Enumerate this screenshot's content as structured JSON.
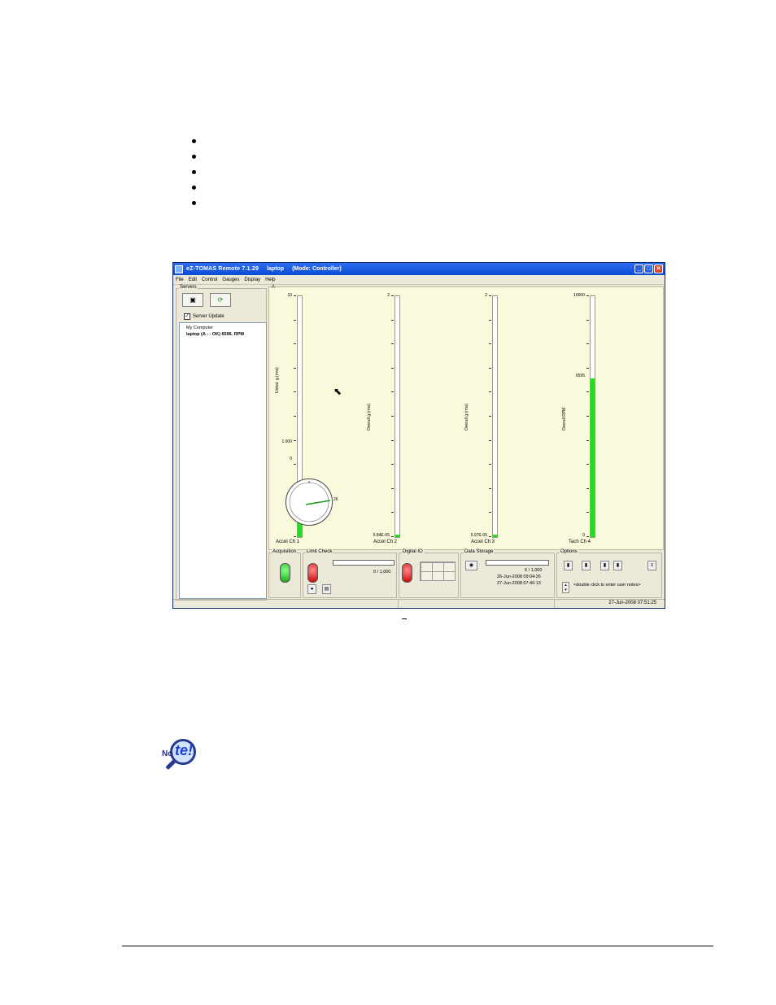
{
  "window": {
    "title": "eZ-TOMAS Remote 7.1.29",
    "server": "laptop",
    "mode": "(Mode:  Controller)",
    "min": "_",
    "max": "□",
    "close": "✕"
  },
  "menu": [
    "File",
    "Edit",
    "Control",
    "Gauges",
    "Display",
    "Help"
  ],
  "servers": {
    "label": "Servers",
    "server_update": "Server Update",
    "tree_root": "My Computer",
    "tree_item": "laptop   (A - -   OK)   6596. RPM"
  },
  "panel_label": "A",
  "gauges": [
    {
      "name": "Accel Ch 1",
      "axis": "Unbal. g (rms)",
      "top": "10",
      "marks": [
        "1.000",
        "0"
      ],
      "level": 0.085
    },
    {
      "name": "Accel Ch 2",
      "axis": "Overall   g (rms)",
      "top": "2",
      "marks": [
        "5.84E-05"
      ],
      "level": 0.01
    },
    {
      "name": "Accel Ch 3",
      "axis": "Overall   g (rms)",
      "top": "2",
      "marks": [
        "5.97E-05"
      ],
      "level": 0.01
    },
    {
      "name": "Tach Ch 4",
      "axis": "Overall   RPM",
      "top": "10000",
      "marks": [
        "6595",
        "0"
      ],
      "level": 0.6595
    }
  ],
  "dial_label": "26",
  "bottom": {
    "acquisition": "Acquisition",
    "limit_check": "Limit Check",
    "limit_count": "0 / 1,000",
    "digital_io": "Digital IO",
    "data_storage": "Data Storage",
    "storage_count": "6 / 1,000",
    "storage_date1": "26-Jun-2008 09:04:26",
    "storage_date2": "27-Jun-2008 07:46:13",
    "options": "Options",
    "user_notes": "<double click to enter user notes>"
  },
  "status_clock": "27-Jun-2008 07:51:25",
  "caption_mark": "_",
  "note_icon": {
    "small": "No",
    "big": "te!"
  }
}
